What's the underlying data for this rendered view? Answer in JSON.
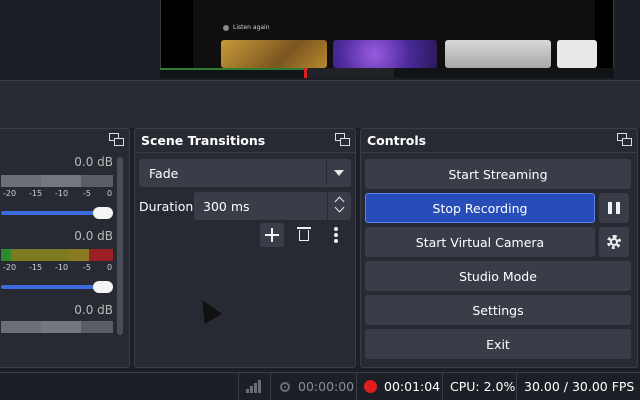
{
  "preview": {
    "captured_text": "Listen again"
  },
  "audio_mixer": {
    "channels": [
      {
        "db": "0.0 dB",
        "ticks": [
          "-20",
          "-15",
          "-10",
          "-5",
          "0"
        ]
      },
      {
        "db": "0.0 dB",
        "ticks": [
          "-20",
          "-15",
          "-10",
          "-5",
          "0"
        ]
      },
      {
        "db": "0.0 dB"
      }
    ]
  },
  "scene_transitions": {
    "title": "Scene Transitions",
    "transition_value": "Fade",
    "duration_label": "Duration",
    "duration_value": "300 ms"
  },
  "controls": {
    "title": "Controls",
    "start_streaming": "Start Streaming",
    "stop_recording": "Stop Recording",
    "start_virtual_camera": "Start Virtual Camera",
    "studio_mode": "Studio Mode",
    "settings": "Settings",
    "exit": "Exit",
    "accent_color": "#284cb8"
  },
  "status_bar": {
    "stream_time": "00:00:00",
    "record_time": "00:01:04",
    "cpu": "CPU: 2.0%",
    "fps": "30.00 / 30.00 FPS",
    "record_color": "#e01e1e"
  },
  "icons": {
    "undock": "undock-icon",
    "add": "plus-icon",
    "delete": "trash-icon",
    "more": "more-vertical-icon",
    "pause": "pause-icon",
    "virtual_camera_settings": "gear-icon",
    "network": "signal-icon",
    "streaming": "broadcast-icon",
    "recording": "record-icon"
  }
}
